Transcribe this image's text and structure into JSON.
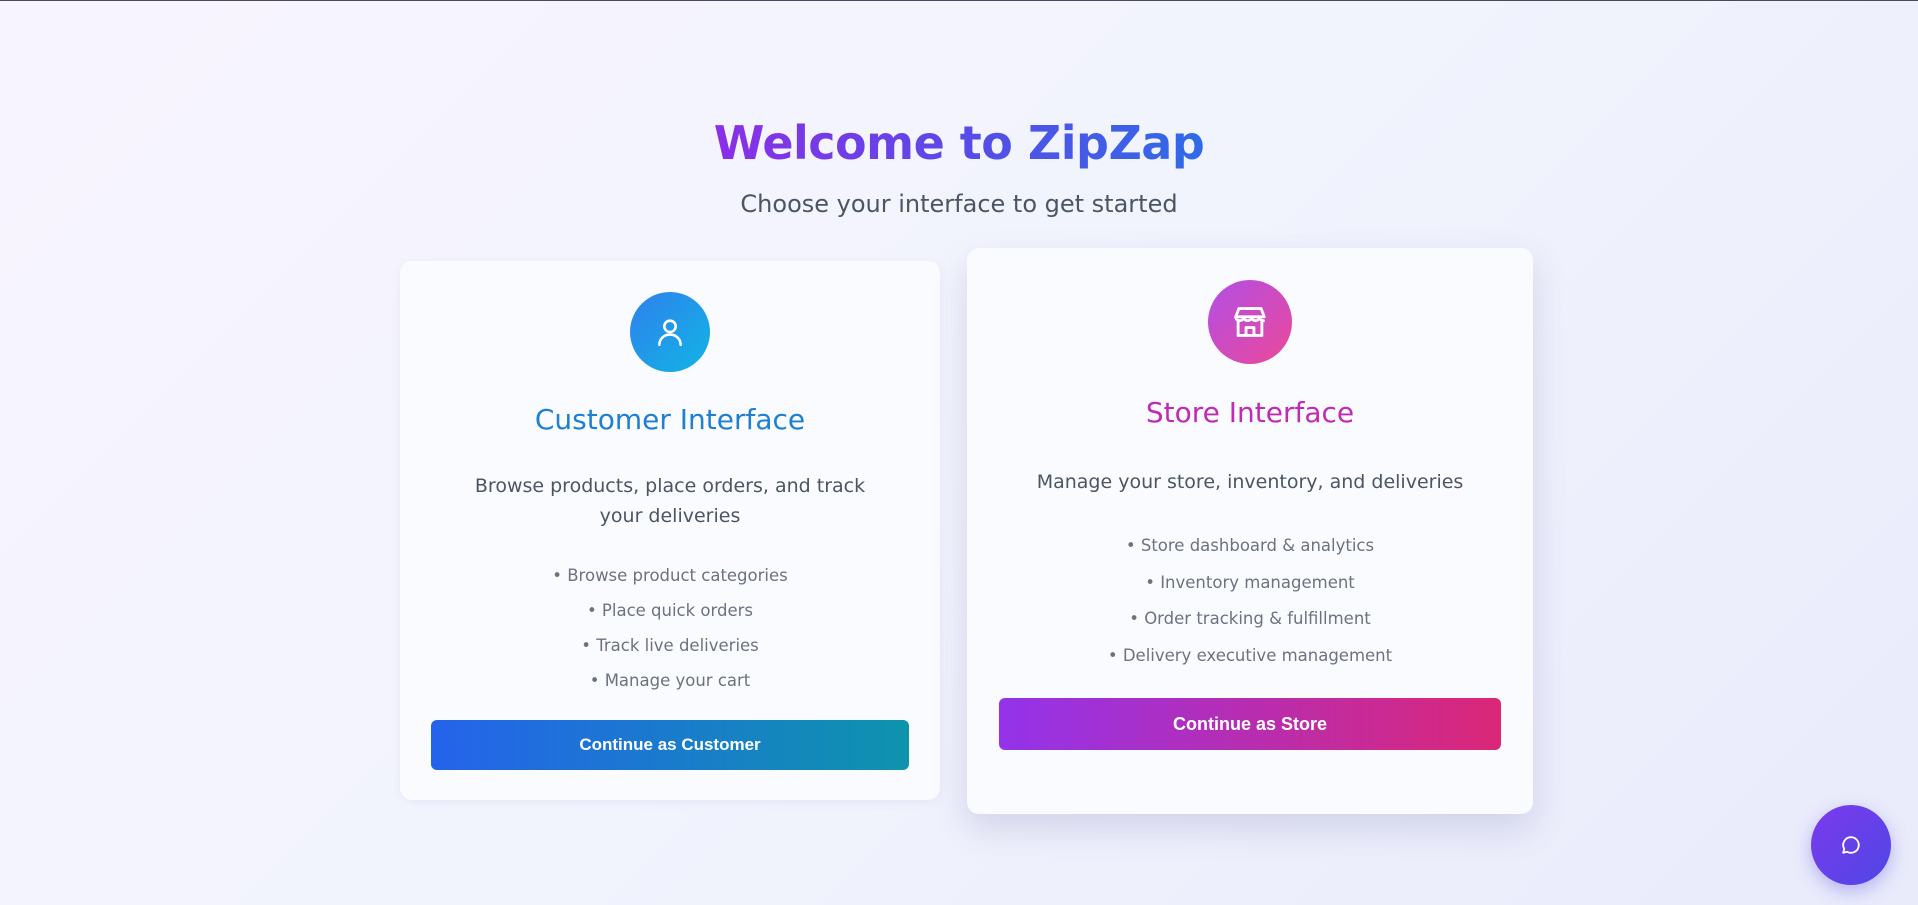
{
  "header": {
    "title": "Welcome to ZipZap",
    "subtitle": "Choose your interface to get started"
  },
  "customer_card": {
    "icon": "user-icon",
    "title": "Customer Interface",
    "description": "Browse products, place orders, and track your deliveries",
    "features": [
      "• Browse product categories",
      "• Place quick orders",
      "• Track live deliveries",
      "• Manage your cart"
    ],
    "button_label": "Continue as Customer",
    "accent": "#1f7fd1"
  },
  "store_card": {
    "icon": "store-icon",
    "title": "Store Interface",
    "description": "Manage your store, inventory, and deliveries",
    "features": [
      "• Store dashboard & analytics",
      "• Inventory management",
      "• Order tracking & fulfillment",
      "• Delivery executive management"
    ],
    "button_label": "Continue as Store",
    "accent": "#c02bb4"
  },
  "chat": {
    "icon": "chat-bubble-icon"
  },
  "colors": {
    "title_gradient_start": "#8b2fe6",
    "title_gradient_end": "#2f6be6",
    "customer_button_start": "#2563eb",
    "customer_button_end": "#0e93ad",
    "store_button_start": "#9333ea",
    "store_button_end": "#db2777"
  }
}
